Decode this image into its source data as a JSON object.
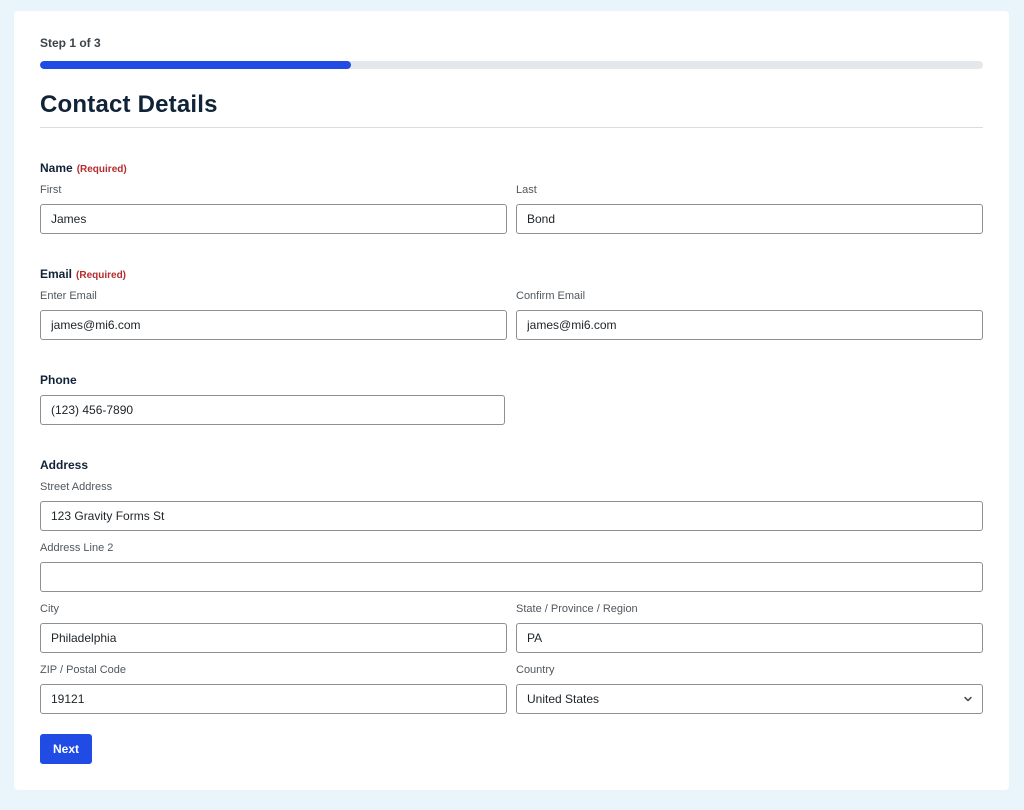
{
  "progress": {
    "step_text": "Step 1 of 3",
    "fraction": 0.33
  },
  "page": {
    "title": "Contact Details"
  },
  "name": {
    "legend": "Name",
    "required": "(Required)",
    "first_label": "First",
    "first_value": "James",
    "last_label": "Last",
    "last_value": "Bond"
  },
  "email": {
    "legend": "Email",
    "required": "(Required)",
    "enter_label": "Enter Email",
    "enter_value": "james@mi6.com",
    "confirm_label": "Confirm Email",
    "confirm_value": "james@mi6.com"
  },
  "phone": {
    "legend": "Phone",
    "value": "(123) 456-7890"
  },
  "address": {
    "legend": "Address",
    "street_label": "Street Address",
    "street_value": "123 Gravity Forms St",
    "line2_label": "Address Line 2",
    "line2_value": "",
    "city_label": "City",
    "city_value": "Philadelphia",
    "state_label": "State / Province / Region",
    "state_value": "PA",
    "zip_label": "ZIP / Postal Code",
    "zip_value": "19121",
    "country_label": "Country",
    "country_value": "United States"
  },
  "actions": {
    "next_label": "Next"
  },
  "colors": {
    "accent": "#204ce5",
    "required": "#b32d2e",
    "title": "#112337",
    "background": "#eaf4fb"
  },
  "icons": {
    "country_dropdown": "chevron-down-icon"
  }
}
